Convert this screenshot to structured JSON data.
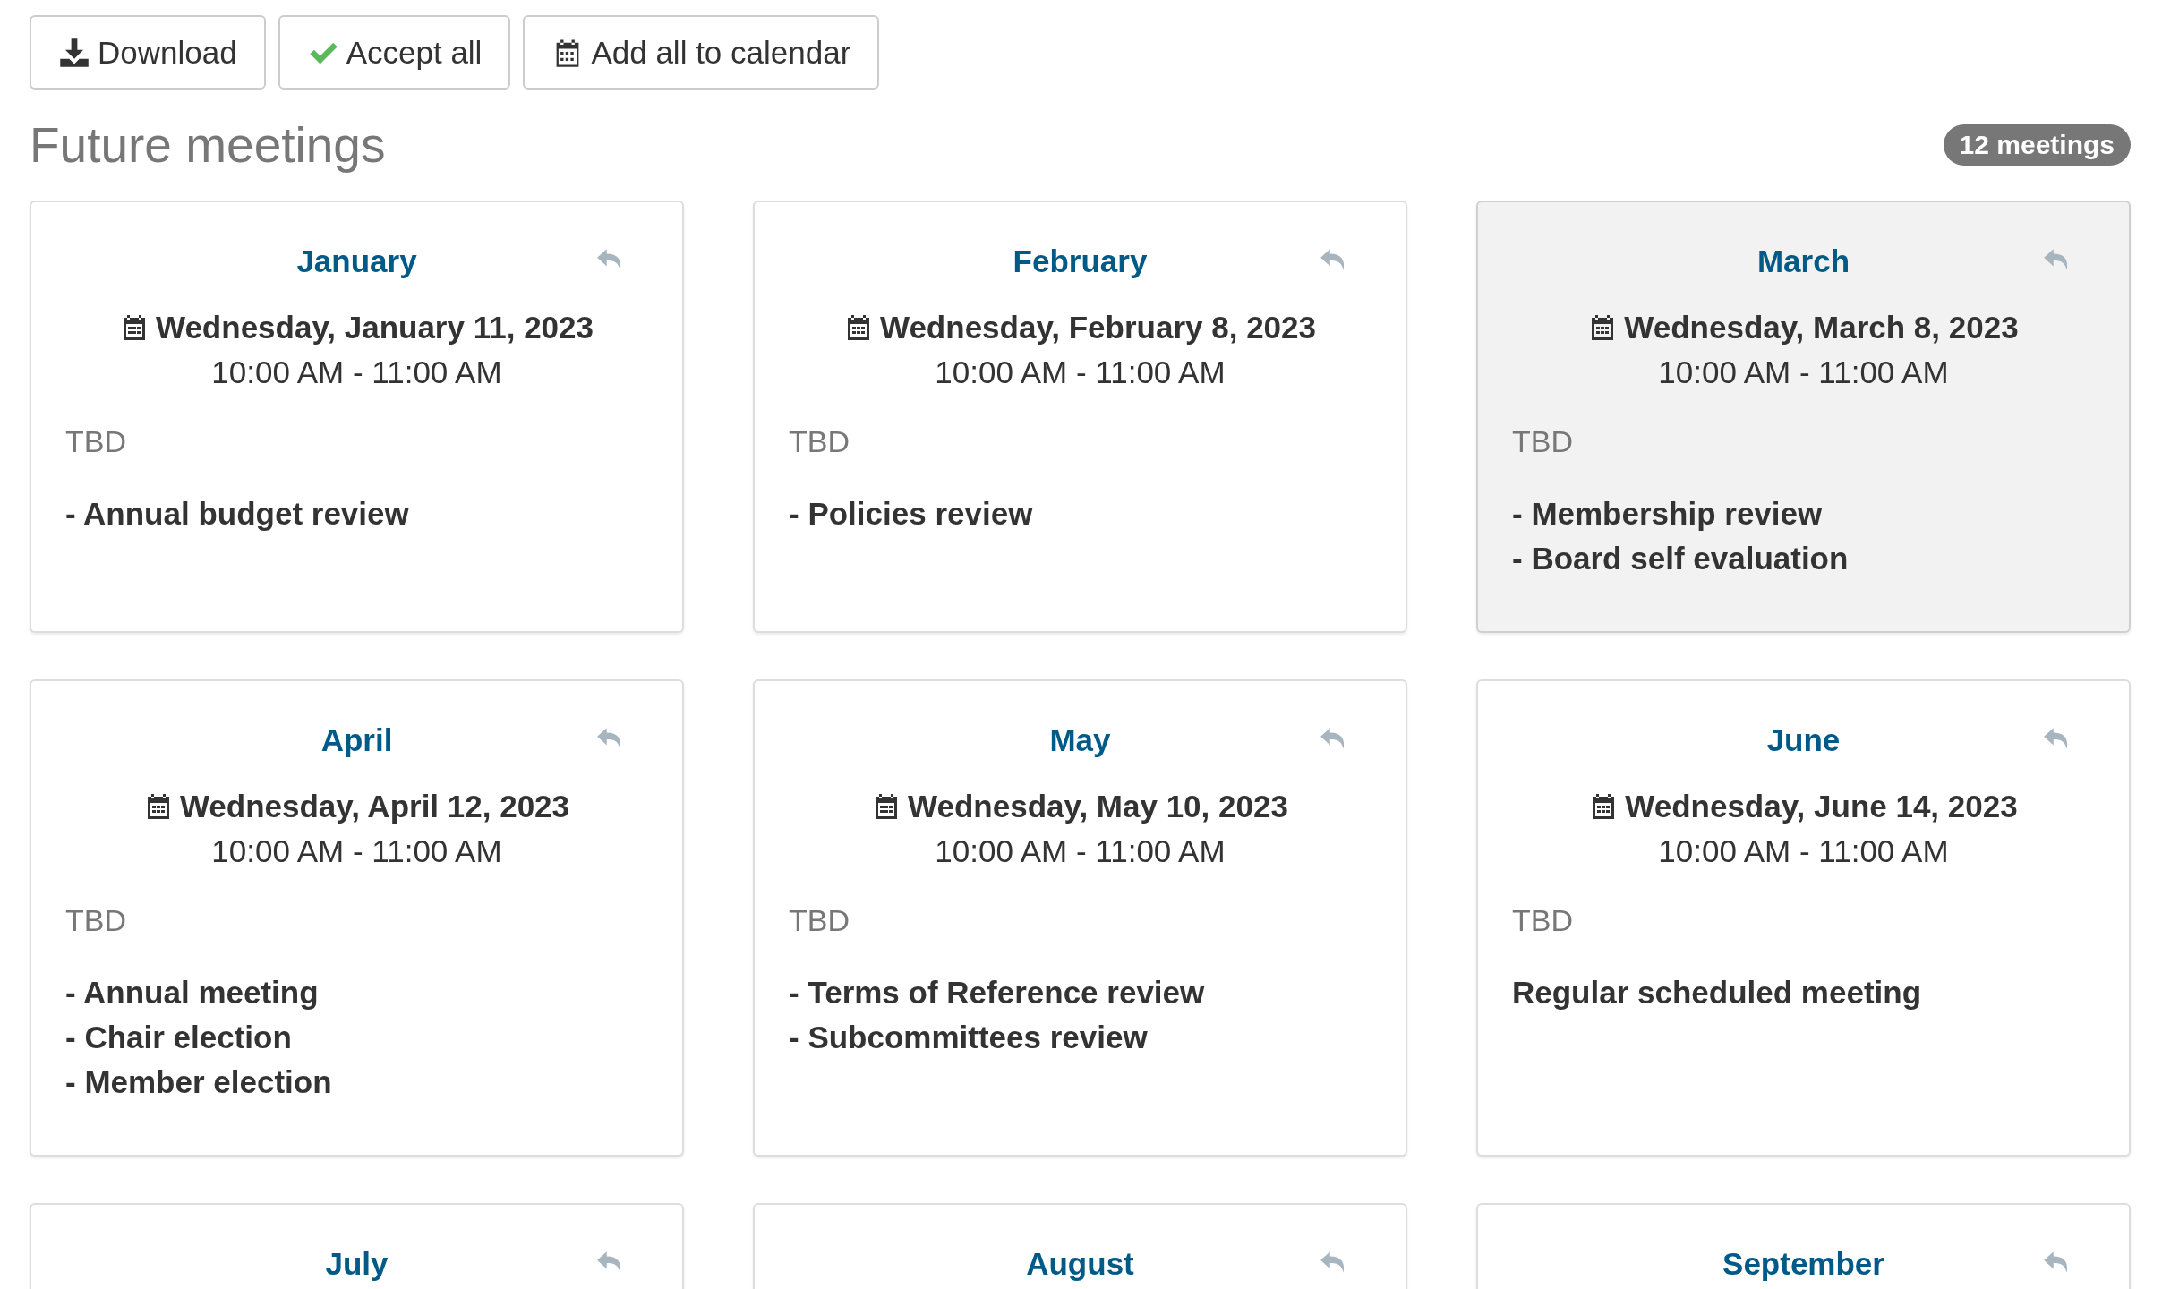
{
  "toolbar": {
    "buttons": [
      {
        "kind": "download",
        "label": "Download"
      },
      {
        "kind": "accept",
        "label": "Accept all"
      },
      {
        "kind": "calendar",
        "label": "Add all to calendar"
      }
    ]
  },
  "section": {
    "title": "Future meetings",
    "badge": "12 meetings"
  },
  "meetings": [
    {
      "month": "January",
      "date": "Wednesday, January 11, 2023",
      "time": "10:00 AM - 11:00 AM",
      "location": "TBD",
      "agenda": [
        "- Annual budget review"
      ],
      "highlighted": false
    },
    {
      "month": "February",
      "date": "Wednesday, February 8, 2023",
      "time": "10:00 AM - 11:00 AM",
      "location": "TBD",
      "agenda": [
        "- Policies review"
      ],
      "highlighted": false
    },
    {
      "month": "March",
      "date": "Wednesday, March 8, 2023",
      "time": "10:00 AM - 11:00 AM",
      "location": "TBD",
      "agenda": [
        "- Membership review",
        "- Board self evaluation"
      ],
      "highlighted": true
    },
    {
      "month": "April",
      "date": "Wednesday, April 12, 2023",
      "time": "10:00 AM - 11:00 AM",
      "location": "TBD",
      "agenda": [
        "- Annual meeting",
        "- Chair election",
        "- Member election"
      ],
      "highlighted": false
    },
    {
      "month": "May",
      "date": "Wednesday, May 10, 2023",
      "time": "10:00 AM - 11:00 AM",
      "location": "TBD",
      "agenda": [
        "- Terms of Reference review",
        "- Subcommittees review"
      ],
      "highlighted": false
    },
    {
      "month": "June",
      "date": "Wednesday, June 14, 2023",
      "time": "10:00 AM - 11:00 AM",
      "location": "TBD",
      "agenda": [
        "Regular scheduled meeting"
      ],
      "highlighted": false
    },
    {
      "month": "July",
      "highlighted": false
    },
    {
      "month": "August",
      "highlighted": false
    },
    {
      "month": "September",
      "highlighted": false
    }
  ]
}
